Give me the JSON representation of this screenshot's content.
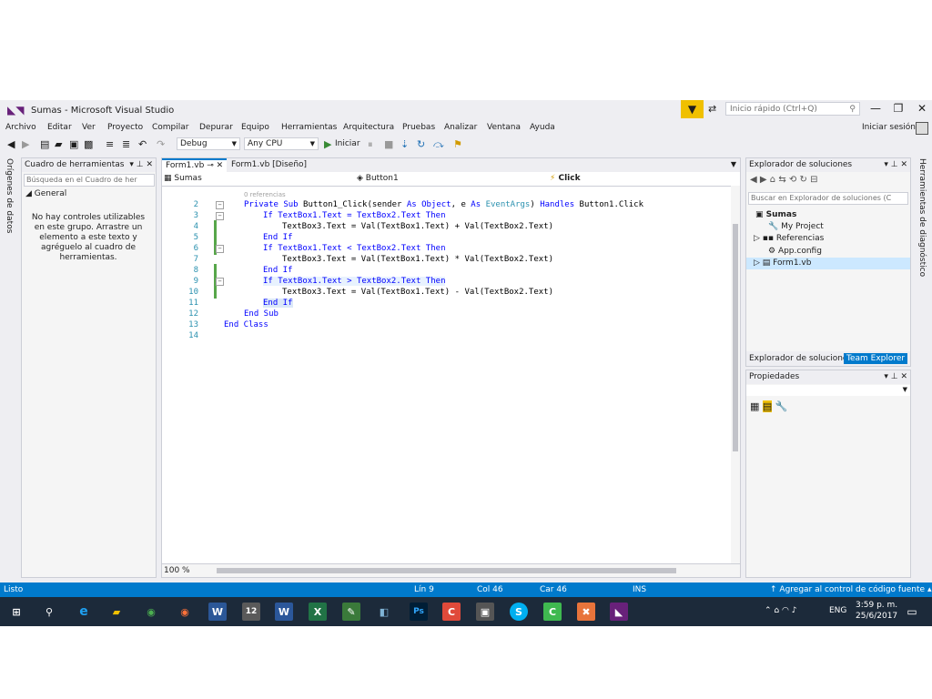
{
  "window": {
    "title": "Sumas - Microsoft Visual Studio"
  },
  "quick_launch": {
    "placeholder": "Inicio rápido (Ctrl+Q)"
  },
  "menu": [
    "Archivo",
    "Editar",
    "Ver",
    "Proyecto",
    "Compilar",
    "Depurar",
    "Equipo",
    "Herramientas",
    "Arquitectura",
    "Pruebas",
    "Analizar",
    "Ventana",
    "Ayuda"
  ],
  "signin": "Iniciar sesión",
  "toolbar": {
    "config": "Debug",
    "platform": "Any CPU",
    "start": "Iniciar"
  },
  "left_strip": "Orígenes de datos",
  "toolbox": {
    "title": "Cuadro de herramientas",
    "search_placeholder": "Búsqueda en el Cuadro de her",
    "group": "General",
    "empty_message": "No hay controles utilizables en este grupo. Arrastre un elemento a este texto y agréguelo al cuadro de herramientas."
  },
  "editor": {
    "tabs": [
      {
        "label": "Form1.vb"
      },
      {
        "label": "Form1.vb [Diseño]"
      }
    ],
    "nav": {
      "left": "Sumas",
      "middle": "Button1",
      "right": "Click"
    },
    "ref_hint": "0 referencias",
    "lines": [
      {
        "n": "2",
        "kw1": "Private Sub ",
        "rest": "Button1_Click(sender ",
        "kw2": "As Object",
        "mid": ", e ",
        "kw3": "As ",
        "ty": "EventArgs",
        "tail": ") ",
        "kw4": "Handles ",
        "end": "Button1.Click"
      },
      {
        "n": "3",
        "text": "If TextBox1.Text = TextBox2.Text Then"
      },
      {
        "n": "4",
        "text": "TextBox3.Text = Val(TextBox1.Text) + Val(TextBox2.Text)"
      },
      {
        "n": "5",
        "text": "End If"
      },
      {
        "n": "6",
        "text": "If TextBox1.Text < TextBox2.Text Then"
      },
      {
        "n": "7",
        "text": "TextBox3.Text = Val(TextBox1.Text) * Val(TextBox2.Text)"
      },
      {
        "n": "8",
        "text": "End If"
      },
      {
        "n": "9",
        "text": "If TextBox1.Text > TextBox2.Text Then"
      },
      {
        "n": "10",
        "text": "TextBox3.Text = Val(TextBox1.Text) - Val(TextBox2.Text)"
      },
      {
        "n": "11",
        "text": "End If"
      },
      {
        "n": "12",
        "text": "End Sub"
      },
      {
        "n": "13",
        "text": "End Class"
      },
      {
        "n": "14",
        "text": ""
      }
    ],
    "zoom": "100 %"
  },
  "solution_explorer": {
    "title": "Explorador de soluciones",
    "search_placeholder": "Buscar en Explorador de soluciones (C",
    "items": [
      "Sumas",
      "My Project",
      "Referencias",
      "App.config",
      "Form1.vb"
    ],
    "tabs": [
      "Explorador de soluciones",
      "Team Explorer"
    ]
  },
  "properties": {
    "title": "Propiedades"
  },
  "right_strip": "Herramientas de diagnóstico",
  "status": {
    "ready": "Listo",
    "line": "Lín 9",
    "col": "Col 46",
    "car": "Car 46",
    "ins": "INS",
    "source_control": "Agregar al control de código fuente"
  },
  "taskbar": {
    "lang": "ENG",
    "time": "3:59 p. m.",
    "date": "25/6/2017"
  }
}
